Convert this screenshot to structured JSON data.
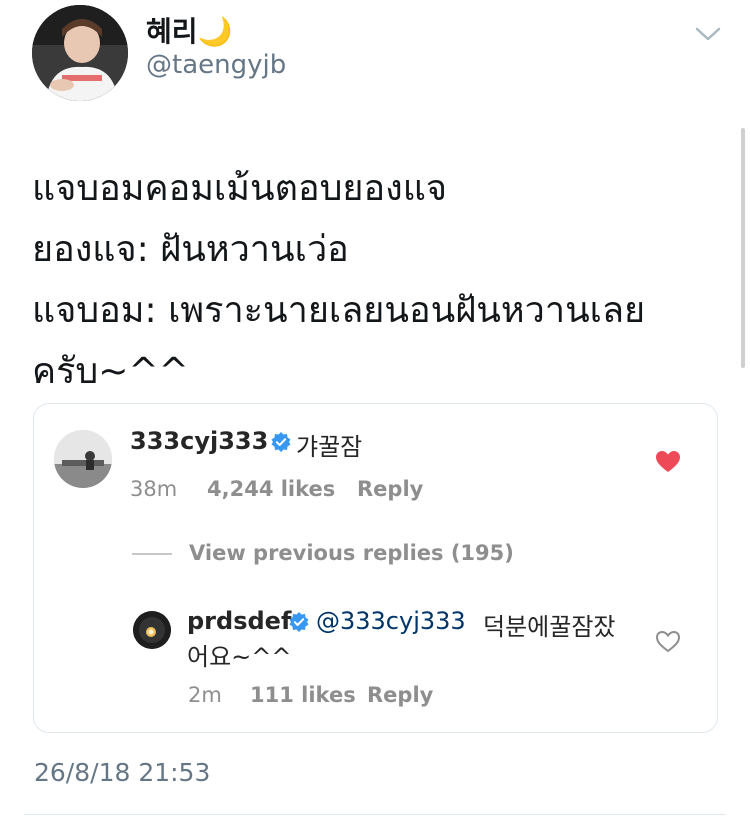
{
  "tweet": {
    "display_name": "혜리",
    "display_name_emoji": "🌙",
    "handle": "@taengyjb",
    "text_lines": [
      "แจบอมคอมเม้นตอบยองแจ",
      "ยองแจ: ฝันหวานเว่อ",
      "แจบอม: เพราะนายเลยนอนฝันหวานเลย",
      "ครับ~^^"
    ],
    "timestamp": "26/8/18 21:53"
  },
  "card": {
    "comment1": {
      "username": "333cyj333",
      "text": "갸꿀잠",
      "time": "38m",
      "likes": "4,244 likes",
      "reply": "Reply"
    },
    "view_previous": "View previous replies (195)",
    "comment2": {
      "username": "prdsdef",
      "mention": "@333cyj333",
      "text_line1": "덕분에꿀잠잤",
      "text_line2": "어요~^^",
      "time": "2m",
      "likes": "111 likes",
      "reply": "Reply"
    }
  },
  "colors": {
    "heart_liked": "#ed4956",
    "verified": "#3897f0",
    "mention": "#003569",
    "meta_gray": "#8e8e8e",
    "handle_gray": "#657786"
  }
}
